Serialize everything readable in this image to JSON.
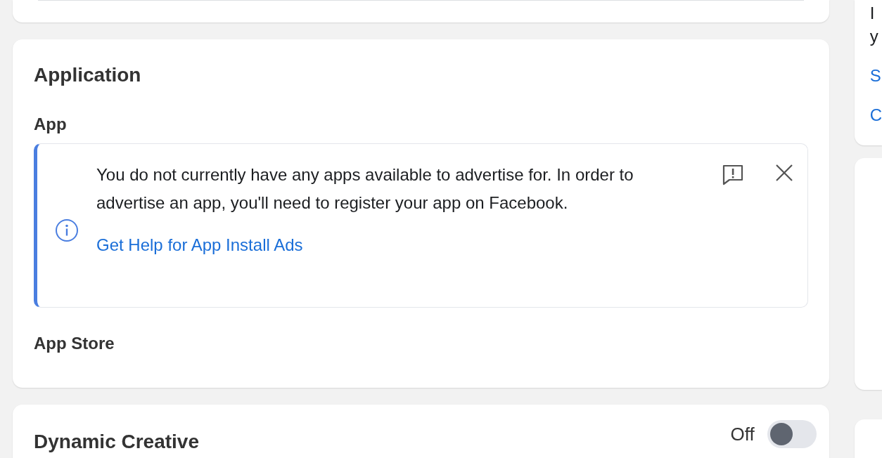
{
  "application": {
    "title": "Application",
    "app_label": "App",
    "notice": {
      "message": "You do not currently have any apps available to advertise for. In order to advertise an app, you'll need to register your app on Facebook.",
      "link": "Get Help for App Install Ads"
    },
    "app_store_label": "App Store"
  },
  "dynamic_creative": {
    "title": "Dynamic Creative",
    "toggle": {
      "label": "Off",
      "on": false
    }
  },
  "side_panel": {
    "lines": [
      {
        "text": "I",
        "kind": "plain"
      },
      {
        "text": "y",
        "kind": "plain"
      },
      {
        "text": "S",
        "kind": "link"
      },
      {
        "text": "C",
        "kind": "link"
      }
    ]
  }
}
